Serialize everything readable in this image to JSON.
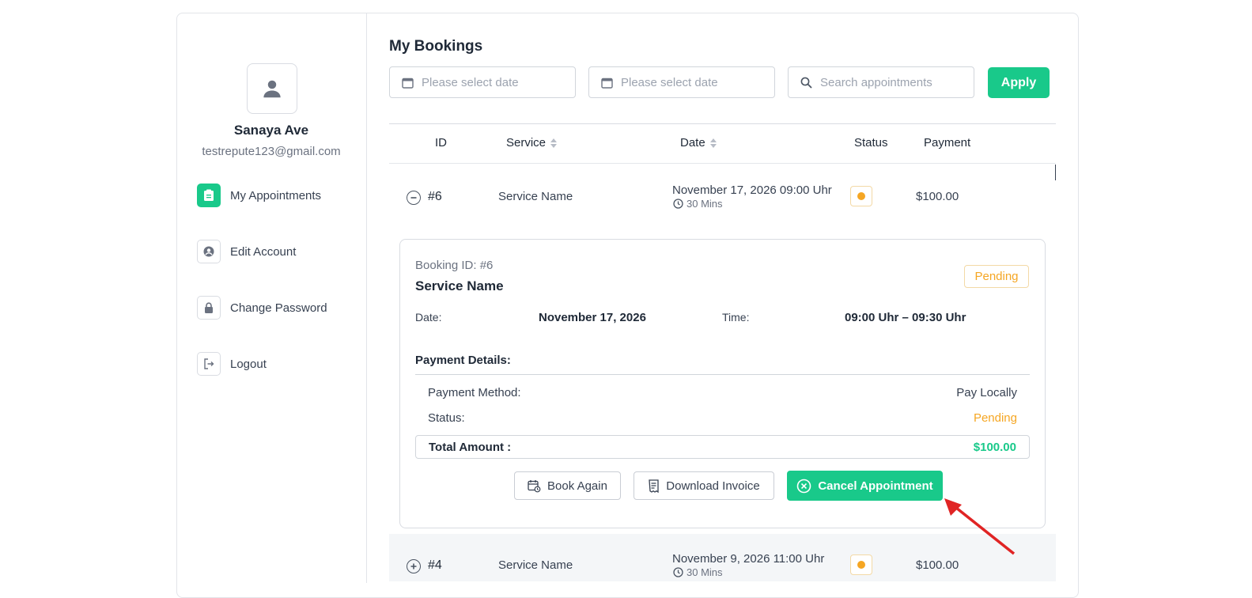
{
  "user": {
    "name": "Sanaya Ave",
    "email": "testrepute123@gmail.com"
  },
  "sidebar": {
    "items": [
      {
        "label": "My Appointments",
        "icon": "clipboard-icon",
        "active": true
      },
      {
        "label": "Edit Account",
        "icon": "user-circle-icon",
        "active": false
      },
      {
        "label": "Change Password",
        "icon": "lock-icon",
        "active": false
      },
      {
        "label": "Logout",
        "icon": "logout-icon",
        "active": false
      }
    ]
  },
  "main": {
    "title": "My Bookings",
    "filters": {
      "date_from_placeholder": "Please select date",
      "date_to_placeholder": "Please select date",
      "search_placeholder": "Search appointments",
      "apply_label": "Apply"
    },
    "table": {
      "headers": {
        "id": "ID",
        "service": "Service",
        "date": "Date",
        "status": "Status",
        "payment": "Payment"
      },
      "rows": [
        {
          "id": "#6",
          "service": "Service Name",
          "date": "November 17, 2026 09:00 Uhr",
          "duration": "30 Mins",
          "payment": "$100.00",
          "expanded": true
        },
        {
          "id": "#4",
          "service": "Service Name",
          "date": "November 9, 2026 11:00 Uhr",
          "duration": "30 Mins",
          "payment": "$100.00",
          "expanded": false
        }
      ]
    },
    "detail": {
      "booking_id": "Booking ID: #6",
      "service": "Service Name",
      "status_badge": "Pending",
      "date_label": "Date:",
      "date_value": "November 17, 2026",
      "time_label": "Time:",
      "time_value": "09:00 Uhr – 09:30 Uhr",
      "payment_details_title": "Payment Details:",
      "payment_method_label": "Payment Method:",
      "payment_method_value": "Pay Locally",
      "status_label": "Status:",
      "status_value": "Pending",
      "total_label": "Total Amount :",
      "total_value": "$100.00",
      "actions": {
        "book_again": "Book Again",
        "download_invoice": "Download Invoice",
        "cancel": "Cancel Appointment"
      }
    }
  },
  "colors": {
    "accent": "#19c98a",
    "pending": "#f5a623",
    "annotation_arrow": "#e02424"
  }
}
